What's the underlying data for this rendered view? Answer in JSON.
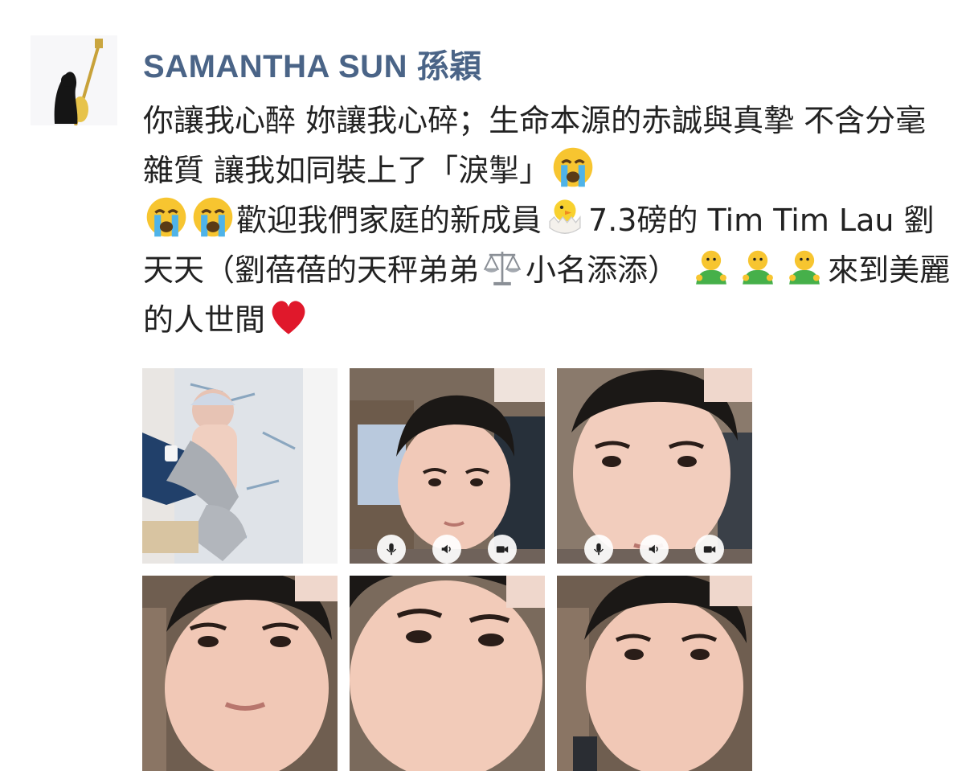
{
  "post": {
    "author": "SAMANTHA SUN 孫穎",
    "avatar_icon": "guitar-silhouette-avatar",
    "text": {
      "segment_1": "你讓我心醉 妳讓我心碎；生命本源的赤誠與真摯 不含分毫雜質 讓我如同裝上了「淚掣」",
      "segment_2": "歡迎我們家庭的新成員",
      "segment_3": "7.3磅的 Tim Tim Lau 劉天天（劉蓓蓓的天秤弟弟",
      "segment_4": "小名添添）",
      "segment_5": "來到美麗的人世間"
    },
    "emoji_names": {
      "crying": "loudly-crying-face-emoji",
      "chick": "hatching-chick-emoji",
      "scales": "balance-scale-emoji",
      "baby": "baby-in-green-emoji",
      "heart": "red-heart-emoji"
    },
    "photos": [
      {
        "name": "newborn-photo",
        "desc": "newborn"
      },
      {
        "name": "video-call-photo-1",
        "controls": [
          "mic-icon",
          "speaker-icon",
          "camera-icon"
        ]
      },
      {
        "name": "video-call-photo-2",
        "controls": [
          "mic-icon",
          "speaker-icon",
          "camera-icon"
        ]
      },
      {
        "name": "video-call-photo-3"
      },
      {
        "name": "video-call-photo-4"
      },
      {
        "name": "video-call-photo-5"
      }
    ],
    "colors": {
      "author": "#4a6487",
      "text": "#222222",
      "background": "#ffffff"
    }
  }
}
